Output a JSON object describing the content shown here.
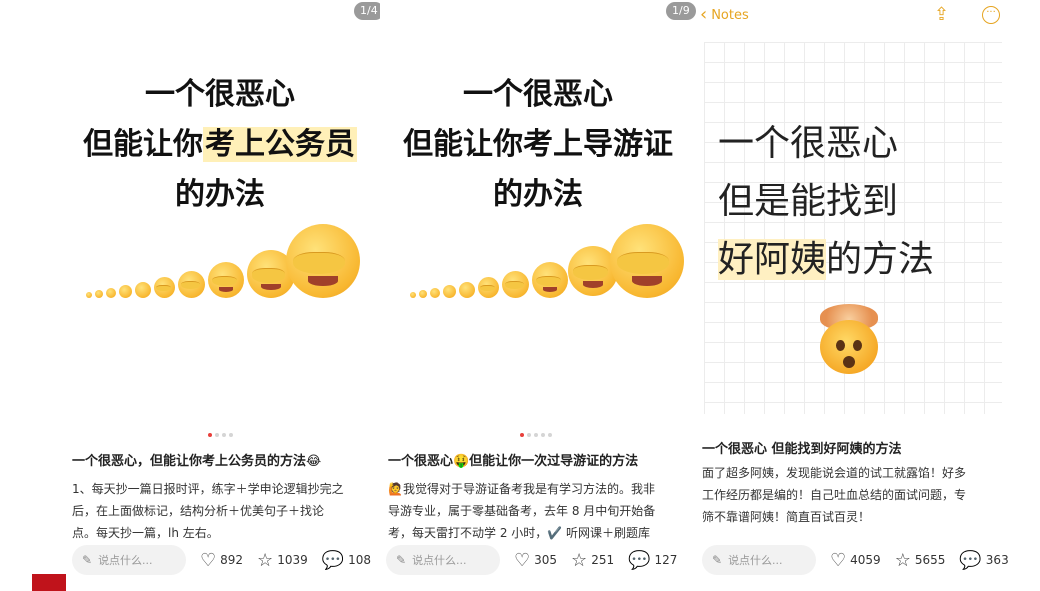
{
  "posts": [
    {
      "counter": "1/4",
      "hero": {
        "line1": "一个很恶心",
        "line2_pre": "但能让你",
        "line2_hl": "考上公务员",
        "line3": "的办法"
      },
      "title": "一个很恶心，但能让你考上公务员的方法😂",
      "body": [
        "1、每天抄一篇日报时评，练字＋学申论逻辑抄完之",
        "后，在上面做标记，结构分析＋优美句子＋找论",
        "点。每天抄一篇，lh 左右。"
      ],
      "comment_placeholder": "说点什么...",
      "likes": "892",
      "favorites": "1039",
      "comments": "108"
    },
    {
      "counter": "1/9",
      "hero": {
        "line1": "一个很恶心",
        "line2": "但能让你考上导游证",
        "line3": "的办法"
      },
      "title": "一个很恶心🤑但能让你一次过导游证的方法",
      "body": [
        "🙋我觉得对于导游证备考我是有学习方法的。我非",
        "导游专业，属于零基础备考，去年 8 月中旬开始备",
        "考，每天雷打不动学 2 小时，✔️ 听网课＋刷题库"
      ],
      "comment_placeholder": "说点什么...",
      "likes": "305",
      "favorites": "251",
      "comments": "127"
    },
    {
      "notes_back": "Notes",
      "hero": {
        "line1": "一个很恶心",
        "line2": "但是能找到",
        "line3_hl": "好阿姨",
        "line3_post": "的方法"
      },
      "title": "一个很恶心 但能找到好阿姨的方法",
      "body": [
        "面了超多阿姨，发现能说会道的试工就露馅！好多",
        "工作经历都是编的！自己吐血总结的面试问题，专",
        "筛不靠谱阿姨！简直百试百灵！"
      ],
      "comment_placeholder": "说点什么...",
      "likes": "4059",
      "favorites": "5655",
      "comments": "363"
    }
  ],
  "colors": {
    "accent_notes": "#e6a522",
    "highlight": "#fff0b8",
    "active_dot": "#e8403c"
  },
  "icons": {
    "like": "heart-icon",
    "favorite": "star-icon",
    "comment": "speech-bubble-icon",
    "pen": "pencil-icon"
  }
}
